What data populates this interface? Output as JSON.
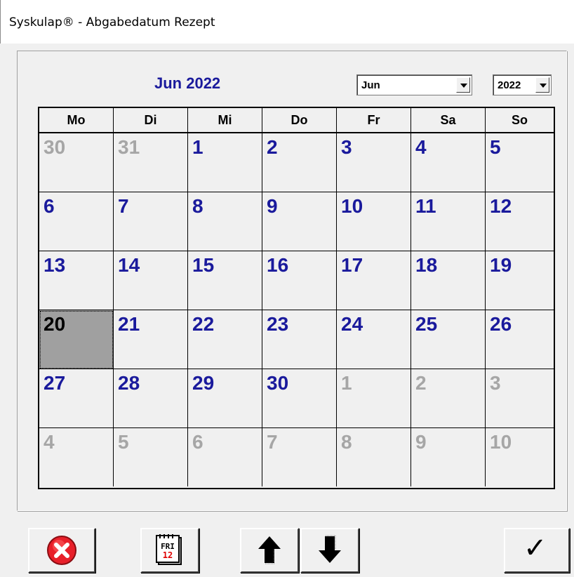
{
  "window": {
    "title": "Syskulap® - Abgabedatum Rezept"
  },
  "calendar": {
    "month_title": "Jun 2022",
    "month_select": {
      "value": "Jun"
    },
    "year_select": {
      "value": "2022"
    },
    "weekdays": [
      "Mo",
      "Di",
      "Mi",
      "Do",
      "Fr",
      "Sa",
      "So"
    ],
    "weeks": [
      [
        "30",
        "31",
        "1",
        "2",
        "3",
        "4",
        "5"
      ],
      [
        "6",
        "7",
        "8",
        "9",
        "10",
        "11",
        "12"
      ],
      [
        "13",
        "14",
        "15",
        "16",
        "17",
        "18",
        "19"
      ],
      [
        "20",
        "21",
        "22",
        "23",
        "24",
        "25",
        "26"
      ],
      [
        "27",
        "28",
        "29",
        "30",
        "1",
        "2",
        "3"
      ],
      [
        "4",
        "5",
        "6",
        "7",
        "8",
        "9",
        "10"
      ]
    ],
    "selected_day": "20",
    "colors": {
      "current_month": "#1a1a9c",
      "other_month": "#a6a6a6",
      "selected_bg": "#a0a0a0"
    }
  },
  "toolbar": {
    "icons": [
      "cancel-icon",
      "today-calendar-icon",
      "arrow-up-icon",
      "arrow-down-icon",
      "checkmark-icon"
    ],
    "today_icon": {
      "day": "FRI",
      "date": "12"
    },
    "checkmark": "✓"
  }
}
